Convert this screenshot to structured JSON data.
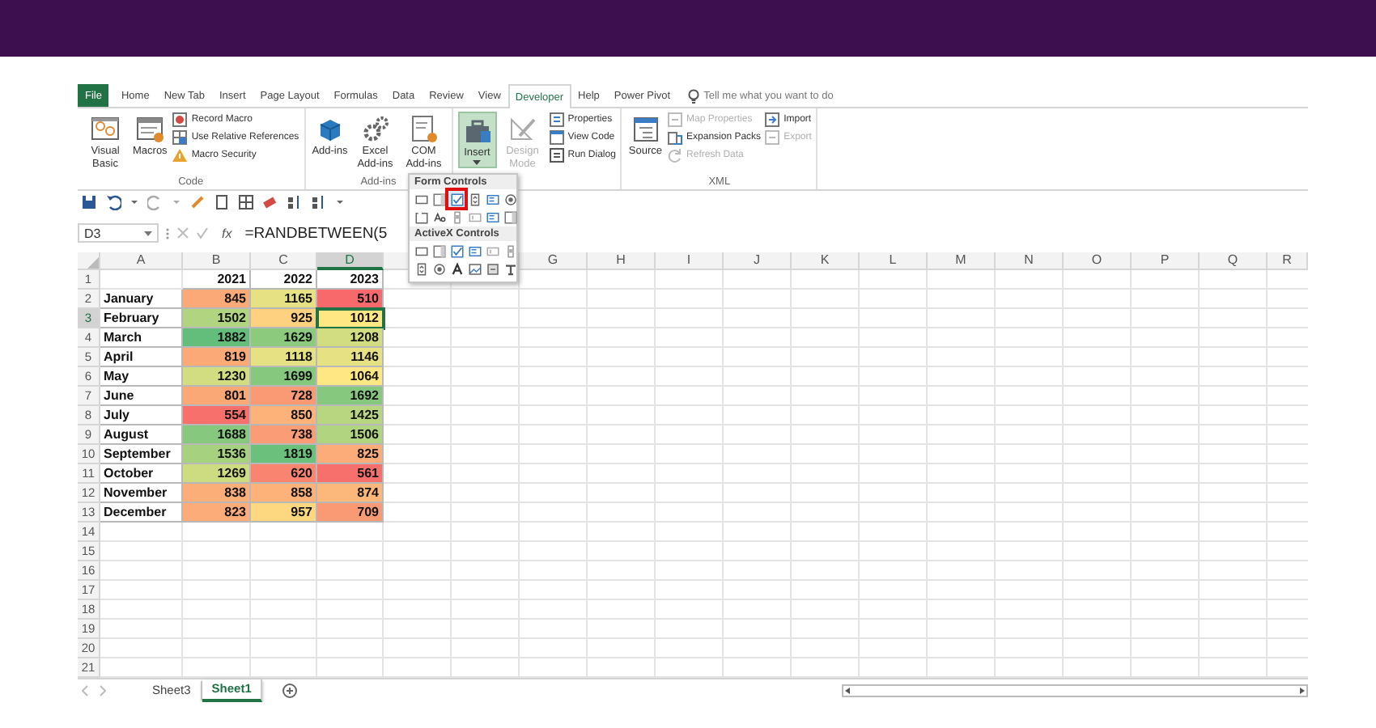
{
  "ribbon_tabs": [
    {
      "label": "File",
      "kind": "file",
      "selected": false
    },
    {
      "label": "Home",
      "kind": "tab",
      "selected": false
    },
    {
      "label": "New Tab",
      "kind": "tab",
      "selected": false
    },
    {
      "label": "Insert",
      "kind": "tab",
      "selected": false
    },
    {
      "label": "Page Layout",
      "kind": "tab",
      "selected": false
    },
    {
      "label": "Formulas",
      "kind": "tab",
      "selected": false
    },
    {
      "label": "Data",
      "kind": "tab",
      "selected": false
    },
    {
      "label": "Review",
      "kind": "tab",
      "selected": false
    },
    {
      "label": "View",
      "kind": "tab",
      "selected": false
    },
    {
      "label": "Developer",
      "kind": "tab",
      "selected": true
    },
    {
      "label": "Help",
      "kind": "tab",
      "selected": false
    },
    {
      "label": "Power Pivot",
      "kind": "tab",
      "selected": false
    }
  ],
  "tell_me": {
    "placeholder": "Tell me what you want to do"
  },
  "ribbon_groups": [
    {
      "label": "Code",
      "commands": [
        {
          "label": "Visual Basic",
          "kind": "large",
          "disabled": false
        },
        {
          "label": "Macros",
          "kind": "large",
          "disabled": false
        },
        {
          "label": "Record Macro",
          "kind": "small",
          "disabled": false
        },
        {
          "label": "Use Relative References",
          "kind": "small",
          "disabled": false
        },
        {
          "label": "Macro Security",
          "kind": "small",
          "disabled": false
        }
      ]
    },
    {
      "label": "Add-ins",
      "commands": [
        {
          "label": "Add-ins",
          "kind": "large",
          "disabled": false
        },
        {
          "label": "Excel Add-ins",
          "kind": "large",
          "disabled": false
        },
        {
          "label": "COM Add-ins",
          "kind": "large",
          "disabled": false
        }
      ]
    },
    {
      "commands": [
        {
          "label": "Insert",
          "kind": "large",
          "disabled": false,
          "selected": true
        },
        {
          "label": "Design Mode",
          "kind": "large",
          "disabled": true,
          "selected": false
        },
        {
          "label": "Properties",
          "kind": "small",
          "disabled": false
        },
        {
          "label": "View Code",
          "kind": "small",
          "disabled": false
        },
        {
          "label": "Run Dialog",
          "kind": "small",
          "disabled": false
        }
      ]
    },
    {
      "label": "XML",
      "commands": [
        {
          "label": "Source",
          "kind": "large",
          "disabled": false
        },
        {
          "label": "Map Properties",
          "kind": "small",
          "disabled": true
        },
        {
          "label": "Expansion Packs",
          "kind": "small",
          "disabled": false
        },
        {
          "label": "Refresh Data",
          "kind": "small",
          "disabled": true
        },
        {
          "label": "Import",
          "kind": "small",
          "disabled": false
        },
        {
          "label": "Export",
          "kind": "small",
          "disabled": true
        }
      ]
    }
  ],
  "name_box": "D3",
  "function_label": "fx",
  "formula": "=RANDBETWEEN(5",
  "controls_menu": {
    "sections": [
      {
        "title": "Form Controls",
        "items": [
          {
            "kind": "button",
            "selected": false
          },
          {
            "kind": "combo",
            "selected": false
          },
          {
            "kind": "checkbox",
            "selected": true
          },
          {
            "kind": "spin",
            "selected": false
          },
          {
            "kind": "list",
            "selected": false
          },
          {
            "kind": "option",
            "selected": false
          },
          {
            "kind": "group",
            "selected": false
          },
          {
            "kind": "label",
            "selected": false
          },
          {
            "kind": "scroll",
            "selected": false
          },
          {
            "kind": "text",
            "selected": false
          },
          {
            "kind": "list",
            "selected": false
          },
          {
            "kind": "combo",
            "selected": false
          }
        ]
      },
      {
        "title": "ActiveX Controls",
        "items": [
          {
            "kind": "button",
            "selected": false
          },
          {
            "kind": "combo",
            "selected": false
          },
          {
            "kind": "checkbox",
            "selected": false
          },
          {
            "kind": "list",
            "selected": false
          },
          {
            "kind": "text",
            "selected": false
          },
          {
            "kind": "scroll",
            "selected": false
          },
          {
            "kind": "spin",
            "selected": false
          },
          {
            "kind": "option",
            "selected": false
          },
          {
            "kind": "biglabel",
            "selected": false
          },
          {
            "kind": "image",
            "selected": false
          },
          {
            "kind": "toggle",
            "selected": false
          },
          {
            "kind": "more",
            "selected": false
          }
        ]
      }
    ]
  },
  "sheet": {
    "columns": [
      {
        "label": "A",
        "selected": false
      },
      {
        "label": "B",
        "selected": false
      },
      {
        "label": "C",
        "selected": false
      },
      {
        "label": "D",
        "selected": true
      },
      {
        "selected": false
      },
      {
        "selected": false
      },
      {
        "label": "G",
        "selected": false
      },
      {
        "label": "H",
        "selected": false
      },
      {
        "label": "I",
        "selected": false
      },
      {
        "label": "J",
        "selected": false
      },
      {
        "label": "K",
        "selected": false
      },
      {
        "label": "L",
        "selected": false
      },
      {
        "label": "M",
        "selected": false
      },
      {
        "label": "N",
        "selected": false
      },
      {
        "label": "O",
        "selected": false
      },
      {
        "label": "P",
        "selected": false
      },
      {
        "label": "Q",
        "selected": false
      },
      {
        "label": "R",
        "selected": false
      }
    ],
    "row_headers": [
      {
        "label": "1",
        "selected": false
      },
      {
        "label": "2",
        "selected": false
      },
      {
        "label": "3",
        "selected": true
      },
      {
        "label": "4",
        "selected": false
      },
      {
        "label": "5",
        "selected": false
      },
      {
        "label": "6",
        "selected": false
      },
      {
        "label": "7",
        "selected": false
      },
      {
        "label": "8",
        "selected": false
      },
      {
        "label": "9",
        "selected": false
      },
      {
        "label": "10",
        "selected": false
      },
      {
        "label": "11",
        "selected": false
      },
      {
        "label": "12",
        "selected": false
      },
      {
        "label": "13",
        "selected": false
      },
      {
        "label": "14",
        "selected": false
      },
      {
        "label": "15",
        "selected": false
      },
      {
        "label": "16",
        "selected": false
      },
      {
        "label": "17",
        "selected": false
      },
      {
        "label": "18",
        "selected": false
      },
      {
        "label": "19",
        "selected": false
      },
      {
        "label": "20",
        "selected": false
      },
      {
        "label": "21",
        "selected": false
      }
    ],
    "year_headers": [
      "2021",
      "2022",
      "2023"
    ],
    "rows": [
      {
        "label": "January",
        "values": [
          {
            "text": "845",
            "color": "#fbaa77"
          },
          {
            "text": "1165",
            "color": "#e6e283"
          },
          {
            "text": "510",
            "color": "#f8696b"
          }
        ]
      },
      {
        "label": "February",
        "values": [
          {
            "text": "1502",
            "color": "#b0d47f"
          },
          {
            "text": "925",
            "color": "#fdd17f"
          },
          {
            "text": "1012",
            "color": "#ffe884"
          }
        ]
      },
      {
        "label": "March",
        "values": [
          {
            "text": "1882",
            "color": "#63be7b"
          },
          {
            "text": "1629",
            "color": "#8ccb7e"
          },
          {
            "text": "1208",
            "color": "#d2dd81"
          }
        ]
      },
      {
        "label": "April",
        "values": [
          {
            "text": "819",
            "color": "#fbaa77"
          },
          {
            "text": "1118",
            "color": "#e6e283"
          },
          {
            "text": "1146",
            "color": "#e6e283"
          }
        ]
      },
      {
        "label": "May",
        "values": [
          {
            "text": "1230",
            "color": "#d2dd81"
          },
          {
            "text": "1699",
            "color": "#86c97e"
          },
          {
            "text": "1064",
            "color": "#ffe884"
          }
        ]
      },
      {
        "label": "June",
        "values": [
          {
            "text": "801",
            "color": "#fba877"
          },
          {
            "text": "728",
            "color": "#fa9a75"
          },
          {
            "text": "1692",
            "color": "#86c97e"
          }
        ]
      },
      {
        "label": "July",
        "values": [
          {
            "text": "554",
            "color": "#f8706c"
          },
          {
            "text": "850",
            "color": "#fcb279"
          },
          {
            "text": "1425",
            "color": "#b8d680"
          }
        ]
      },
      {
        "label": "August",
        "values": [
          {
            "text": "1688",
            "color": "#86c97e"
          },
          {
            "text": "738",
            "color": "#fa9c75"
          },
          {
            "text": "1506",
            "color": "#b0d47f"
          }
        ]
      },
      {
        "label": "September",
        "values": [
          {
            "text": "1536",
            "color": "#a6d17e"
          },
          {
            "text": "1819",
            "color": "#6bc17c"
          },
          {
            "text": "825",
            "color": "#fbac78"
          }
        ]
      },
      {
        "label": "October",
        "values": [
          {
            "text": "1269",
            "color": "#cddc81"
          },
          {
            "text": "620",
            "color": "#f98570"
          },
          {
            "text": "561",
            "color": "#f8706c"
          }
        ]
      },
      {
        "label": "November",
        "values": [
          {
            "text": "838",
            "color": "#fbae78"
          },
          {
            "text": "858",
            "color": "#fcb279"
          },
          {
            "text": "874",
            "color": "#fcb87a"
          }
        ]
      },
      {
        "label": "December",
        "values": [
          {
            "text": "823",
            "color": "#fbac78"
          },
          {
            "text": "957",
            "color": "#fed880"
          },
          {
            "text": "709",
            "color": "#fa9a75"
          }
        ]
      }
    ]
  },
  "sheet_tabs": [
    {
      "label": "Sheet3",
      "selected": false
    },
    {
      "label": "Sheet1",
      "selected": true
    }
  ]
}
